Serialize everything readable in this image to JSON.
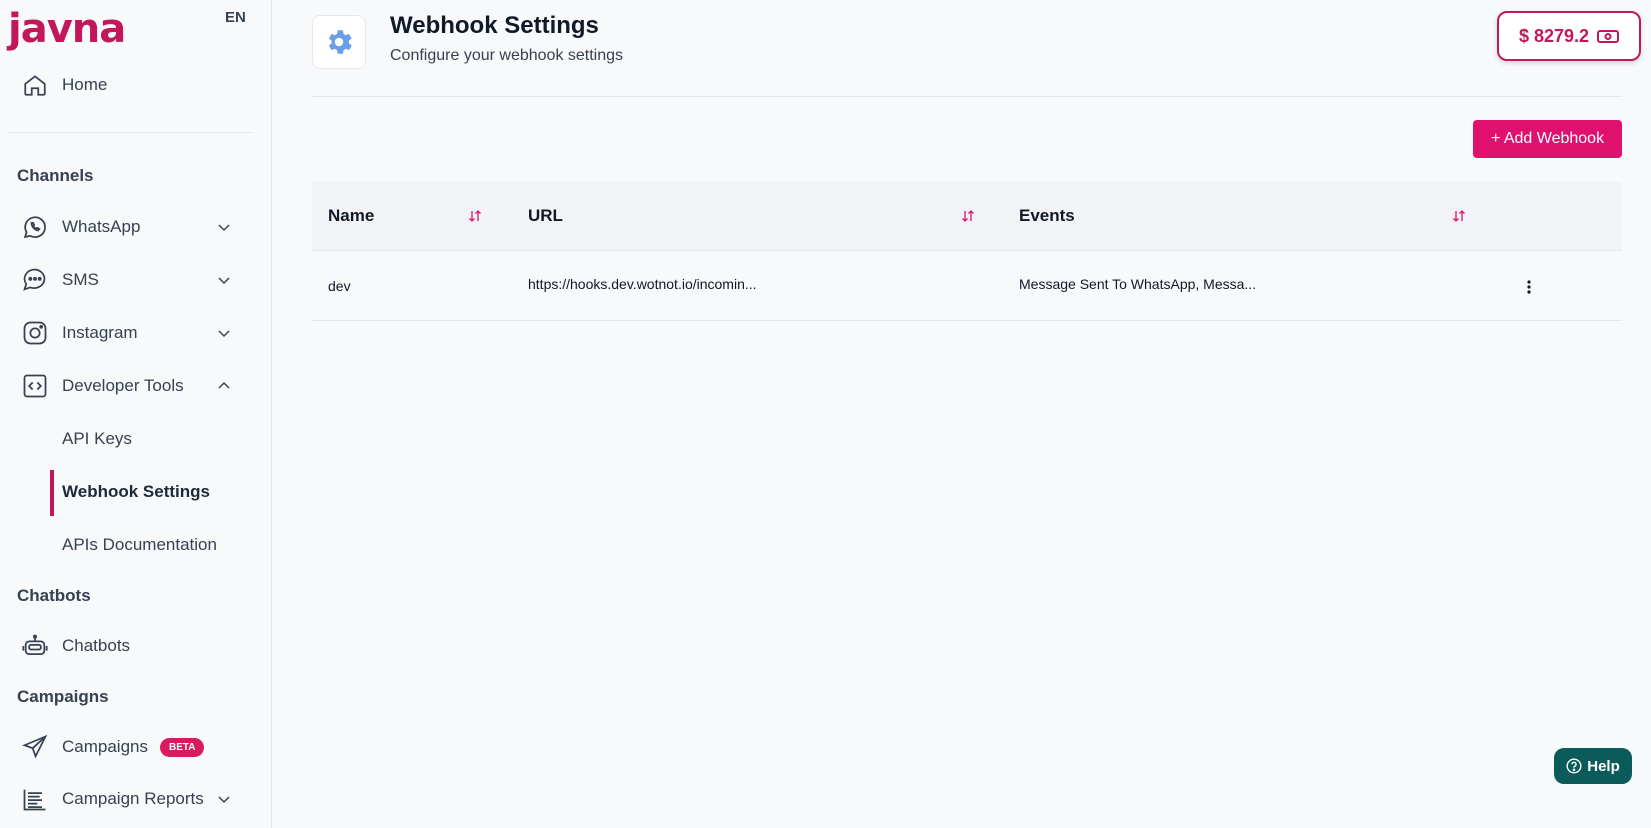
{
  "brand": {
    "logo": "javna",
    "accent": "#c2185b"
  },
  "lang": "EN",
  "sidebar": {
    "home": {
      "label": "Home",
      "icon": "home-icon"
    },
    "channels_heading": "Channels",
    "channels": [
      {
        "label": "WhatsApp",
        "icon": "whatsapp-icon",
        "expanded": false
      },
      {
        "label": "SMS",
        "icon": "sms-icon",
        "expanded": false
      },
      {
        "label": "Instagram",
        "icon": "instagram-icon",
        "expanded": false
      },
      {
        "label": "Developer Tools",
        "icon": "code-icon",
        "expanded": true
      }
    ],
    "dev_tools": [
      {
        "label": "API Keys"
      },
      {
        "label": "Webhook Settings",
        "active": true
      },
      {
        "label": "APIs Documentation"
      }
    ],
    "chatbots_heading": "Chatbots",
    "chatbots": {
      "label": "Chatbots",
      "icon": "robot-icon"
    },
    "campaigns_heading": "Campaigns",
    "campaigns": {
      "label": "Campaigns",
      "badge": "BETA",
      "icon": "send-icon"
    },
    "campaign_reports": {
      "label": "Campaign Reports",
      "icon": "report-icon"
    }
  },
  "header": {
    "title": "Webhook Settings",
    "subtitle": "Configure your webhook settings",
    "balance": "$ 8279.2"
  },
  "actions": {
    "add_webhook": "+ Add Webhook"
  },
  "table": {
    "columns": [
      "Name",
      "URL",
      "Events"
    ],
    "rows": [
      {
        "name": "dev",
        "url": "https://hooks.dev.wotnot.io/incomin...",
        "events": "Message Sent To WhatsApp, Messa..."
      }
    ]
  },
  "help": {
    "label": "Help"
  }
}
